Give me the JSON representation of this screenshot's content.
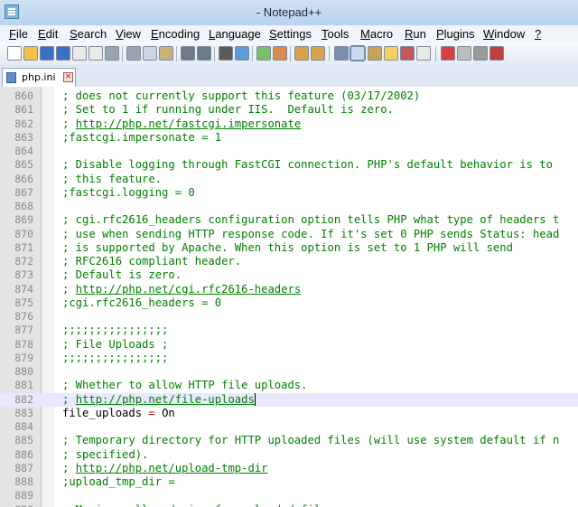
{
  "window": {
    "title": "- Notepad++"
  },
  "menu": [
    "File",
    "Edit",
    "Search",
    "View",
    "Encoding",
    "Language",
    "Settings",
    "Tools",
    "Macro",
    "Run",
    "Plugins",
    "Window",
    "?"
  ],
  "tab": {
    "label": "php.ini"
  },
  "editor": {
    "lines": [
      {
        "n": "860",
        "text": "; does not currently support this feature (03/17/2002)"
      },
      {
        "n": "861",
        "text": "; Set to 1 if running under IIS.  Default is zero."
      },
      {
        "n": "862",
        "pre": "; ",
        "link": "http://php.net/fastcgi.impersonate"
      },
      {
        "n": "863",
        "text": ";fastcgi.impersonate = 1"
      },
      {
        "n": "864",
        "text": ""
      },
      {
        "n": "865",
        "text": "; Disable logging through FastCGI connection. PHP's default behavior is to"
      },
      {
        "n": "866",
        "text": "; this feature."
      },
      {
        "n": "867",
        "text": ";fastcgi.logging = 0"
      },
      {
        "n": "868",
        "text": ""
      },
      {
        "n": "869",
        "text": "; cgi.rfc2616_headers configuration option tells PHP what type of headers t"
      },
      {
        "n": "870",
        "text": "; use when sending HTTP response code. If it's set 0 PHP sends Status: head"
      },
      {
        "n": "871",
        "text": "; is supported by Apache. When this option is set to 1 PHP will send"
      },
      {
        "n": "872",
        "text": "; RFC2616 compliant header."
      },
      {
        "n": "873",
        "text": "; Default is zero."
      },
      {
        "n": "874",
        "pre": "; ",
        "link": "http://php.net/cgi.rfc2616-headers"
      },
      {
        "n": "875",
        "text": ";cgi.rfc2616_headers = 0"
      },
      {
        "n": "876",
        "text": ""
      },
      {
        "n": "877",
        "text": ";;;;;;;;;;;;;;;;"
      },
      {
        "n": "878",
        "text": "; File Uploads ;"
      },
      {
        "n": "879",
        "text": ";;;;;;;;;;;;;;;;"
      },
      {
        "n": "880",
        "text": ""
      },
      {
        "n": "881",
        "text": "; Whether to allow HTTP file uploads."
      },
      {
        "n": "882",
        "pre": "; ",
        "link": "http://php.net/file-uploads",
        "current": true
      },
      {
        "n": "883",
        "key": "file_uploads",
        "op": " = ",
        "val": "On"
      },
      {
        "n": "884",
        "text": ""
      },
      {
        "n": "885",
        "text": "; Temporary directory for HTTP uploaded files (will use system default if n"
      },
      {
        "n": "886",
        "text": "; specified)."
      },
      {
        "n": "887",
        "pre": "; ",
        "link": "http://php.net/upload-tmp-dir"
      },
      {
        "n": "888",
        "text": ";upload_tmp_dir ="
      },
      {
        "n": "889",
        "text": ""
      },
      {
        "n": "890",
        "text": "; Maximum allowed size for uploaded files."
      }
    ]
  },
  "toolbar": {
    "icons": [
      "new-file-icon",
      "open-file-icon",
      "save-icon",
      "save-all-icon",
      "close-icon",
      "close-all-icon",
      "print-icon",
      "cut-icon",
      "copy-icon",
      "paste-icon",
      "undo-icon",
      "redo-icon",
      "find-icon",
      "replace-icon",
      "zoom-in-icon",
      "zoom-out-icon",
      "sync-vertical-icon",
      "sync-horizontal-icon",
      "word-wrap-icon",
      "show-all-chars-icon",
      "indent-guide-icon",
      "user-language-icon",
      "doc-map-icon",
      "function-list-icon",
      "record-macro-icon",
      "stop-record-icon",
      "playback-icon",
      "run-macro-icon"
    ]
  },
  "colors": {
    "comment": "#008000",
    "number": "#8a8a8a",
    "gutter": "#e4e4e4",
    "current_line": "#e8e8ff",
    "operator": "#d00000"
  }
}
